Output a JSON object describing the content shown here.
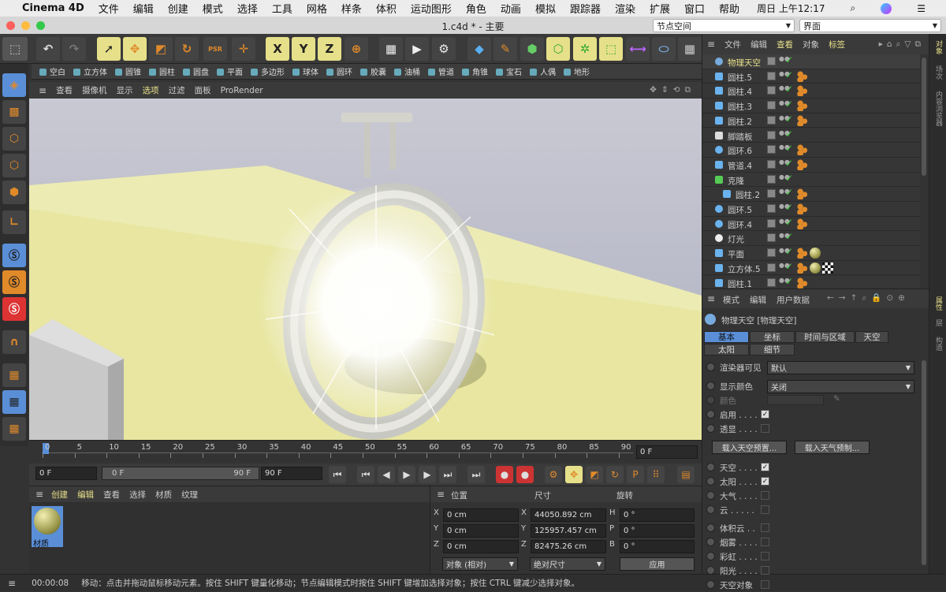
{
  "menubar": {
    "app_name": "Cinema 4D",
    "items": [
      "文件",
      "编辑",
      "创建",
      "模式",
      "选择",
      "工具",
      "网格",
      "样条",
      "体积",
      "运动图形",
      "角色",
      "动画",
      "模拟",
      "跟踪器",
      "渲染",
      "扩展",
      "窗口",
      "帮助"
    ],
    "clock": "周日 上午12:17"
  },
  "titlebar": {
    "title": "1.c4d * - 主要",
    "node_space": "节点空间",
    "layout": "界面"
  },
  "toolbar": {
    "xyz": [
      "X",
      "Y",
      "Z"
    ],
    "psr_label": "PSR"
  },
  "object_bar": {
    "items": [
      "空白",
      "立方体",
      "圆锥",
      "圆柱",
      "圆盘",
      "平面",
      "多边形",
      "球体",
      "圆环",
      "胶囊",
      "油桶",
      "管道",
      "角锥",
      "宝石",
      "人偶",
      "地形"
    ]
  },
  "viewport": {
    "menu": [
      "查看",
      "摄像机",
      "显示",
      "选项",
      "过滤",
      "面板",
      "ProRender"
    ],
    "active_menu": "选项"
  },
  "timeline": {
    "ticks": [
      "0",
      "5",
      "10",
      "15",
      "20",
      "25",
      "30",
      "35",
      "40",
      "45",
      "50",
      "55",
      "60",
      "65",
      "70",
      "75",
      "80",
      "85",
      "90"
    ],
    "current_frame": "0 F"
  },
  "transport": {
    "start": "0 F",
    "range_start": "0 F",
    "range_end": "90 F",
    "end": "90 F"
  },
  "material_panel": {
    "menu": [
      "创建",
      "编辑",
      "查看",
      "选择",
      "材质",
      "纹理"
    ],
    "material_name": "材质"
  },
  "coord_panel": {
    "headers": [
      "位置",
      "尺寸",
      "旋转"
    ],
    "rows": [
      {
        "axis": "X",
        "pos": "0 cm",
        "size_axis": "X",
        "size": "44050.892 cm",
        "rot_axis": "H",
        "rot": "0 °"
      },
      {
        "axis": "Y",
        "pos": "0 cm",
        "size_axis": "Y",
        "size": "125957.457 cm",
        "rot_axis": "P",
        "rot": "0 °"
      },
      {
        "axis": "Z",
        "pos": "0 cm",
        "size_axis": "Z",
        "size": "82475.26 cm",
        "rot_axis": "B",
        "rot": "0 °"
      }
    ],
    "mode": "对象 (相对)",
    "size_mode": "绝对尺寸",
    "apply": "应用"
  },
  "status": {
    "time": "00:00:08",
    "message": "移动：点击并拖动鼠标移动元素。按住 SHIFT 键量化移动；节点编辑模式时按住 SHIFT 键增加选择对象；按住 CTRL 键减少选择对象。"
  },
  "object_manager": {
    "menu": [
      "文件",
      "编辑",
      "查看",
      "对象",
      "标签"
    ],
    "objects": [
      {
        "name": "物理天空",
        "icon": "sky-icon",
        "indent": 0,
        "selected": true,
        "tags": 0
      },
      {
        "name": "圆柱.5",
        "icon": "cylinder-icon",
        "indent": 0,
        "tags": 1
      },
      {
        "name": "圆柱.4",
        "icon": "cylinder-icon",
        "indent": 0,
        "tags": 1
      },
      {
        "name": "圆柱.3",
        "icon": "cylinder-icon",
        "indent": 0,
        "tags": 1
      },
      {
        "name": "圆柱.2",
        "icon": "cylinder-icon",
        "indent": 0,
        "tags": 1
      },
      {
        "name": "脚踏板",
        "icon": "null-icon",
        "indent": 0,
        "tags": 0
      },
      {
        "name": "圆环.6",
        "icon": "torus-icon",
        "indent": 0,
        "tags": 1
      },
      {
        "name": "管道.4",
        "icon": "tube-icon",
        "indent": 0,
        "tags": 1
      },
      {
        "name": "克隆",
        "icon": "cloner-icon",
        "indent": 0,
        "tags": 0
      },
      {
        "name": "圆柱.2",
        "icon": "cylinder-icon",
        "indent": 1,
        "tags": 1
      },
      {
        "name": "圆环.5",
        "icon": "torus-icon",
        "indent": 0,
        "tags": 1
      },
      {
        "name": "圆环.4",
        "icon": "torus-icon",
        "indent": 0,
        "tags": 1
      },
      {
        "name": "灯光",
        "icon": "light-icon",
        "indent": 0,
        "tags": 0
      },
      {
        "name": "平面",
        "icon": "plane-icon",
        "indent": 0,
        "tags": 2
      },
      {
        "name": "立方体.5",
        "icon": "cube-icon",
        "indent": 0,
        "tags": 3
      },
      {
        "name": "圆柱.1",
        "icon": "cylinder-icon",
        "indent": 0,
        "tags": 1
      }
    ]
  },
  "attributes": {
    "menu": [
      "模式",
      "编辑",
      "用户数据"
    ],
    "object_title": "物理天空 [物理天空]",
    "tabs_row1": [
      "基本",
      "坐标",
      "时间与区域",
      "天空"
    ],
    "tabs_row2": [
      "太阳",
      "细节"
    ],
    "active_tab": "基本",
    "renderer_visible_label": "渲染器可见",
    "renderer_visible_value": "默认",
    "display_color_label": "显示颜色",
    "display_color_value": "关闭",
    "color_label": "颜色",
    "enabled_label": "启用 . . . .",
    "transparent_label": "透显 . . . .",
    "load_sky_preset": "载入天空预置...",
    "load_weather_preset": "载入天气预制...",
    "checks": [
      {
        "label": "天空 . . . .",
        "checked": true
      },
      {
        "label": "太阳 . . . .",
        "checked": true
      },
      {
        "label": "大气 . . . .",
        "checked": false
      },
      {
        "label": "云 . . . . .",
        "checked": false
      }
    ],
    "checks2": [
      {
        "label": "体积云 . .",
        "checked": false
      },
      {
        "label": "烟雾 . . . .",
        "checked": false
      },
      {
        "label": "彩虹 . . . .",
        "checked": false
      },
      {
        "label": "阳光 . . . .",
        "checked": false
      },
      {
        "label": "天空对象",
        "checked": false
      }
    ]
  },
  "side_strip": [
    "对象",
    "场次",
    "内容浏览器"
  ],
  "side_strip2": [
    "属性",
    "层",
    "构造"
  ],
  "colors": {
    "accent_orange": "#e08a2a",
    "highlight_yellow": "#e7e08a",
    "active_blue": "#5a8fd8"
  }
}
